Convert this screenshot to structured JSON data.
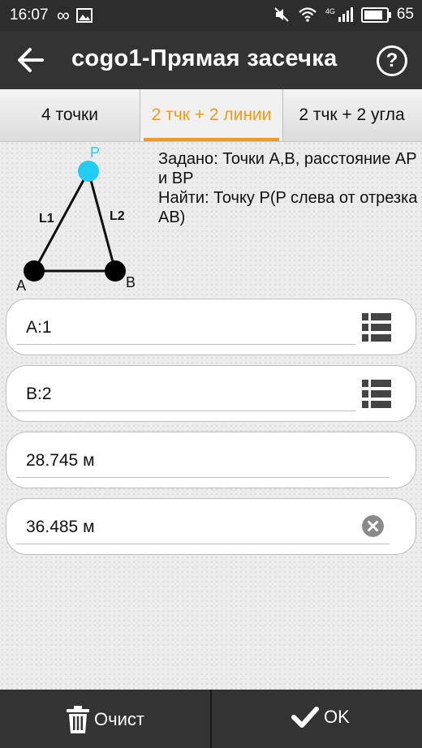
{
  "status_bar": {
    "time": "16:07",
    "network": "4G",
    "battery": "65"
  },
  "app_bar": {
    "title": "cogo1-Прямая засечка",
    "help_label": "?"
  },
  "tabs": [
    {
      "label": "4 точки"
    },
    {
      "label": "2 тчк + 2 линии"
    },
    {
      "label": "2 тчк + 2 угла"
    }
  ],
  "diagram": {
    "labels": {
      "p": "P",
      "a": "A",
      "b": "B",
      "l1": "L1",
      "l2": "L2"
    }
  },
  "description": {
    "given": "Задано: Точки A,B, расстояние AP и BP",
    "find": "Найти: Точку P(P слева от отрезка AB)"
  },
  "fields": [
    {
      "value": "A:1"
    },
    {
      "value": "B:2"
    },
    {
      "value": "28.745 м"
    },
    {
      "value": "36.485 м"
    }
  ],
  "bottom_bar": {
    "clear_label": "Очист",
    "ok_label": "OK"
  },
  "colors": {
    "accent": "#f39a1b",
    "point_p": "#22ccf2",
    "bar_bg": "#333333"
  }
}
